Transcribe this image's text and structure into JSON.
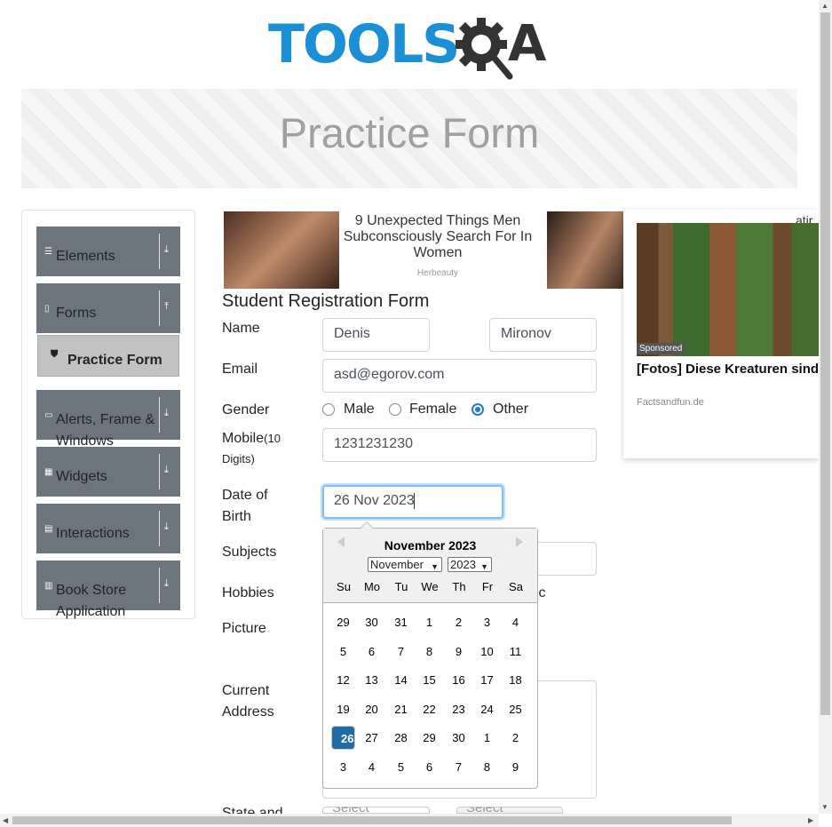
{
  "logo": {
    "text": "TOOLS",
    "text_a": "A",
    "gear_icon": "gear-magnifier-icon"
  },
  "banner": {
    "title": "Practice Form"
  },
  "sidebar": {
    "items": [
      {
        "label": "Elements",
        "icon": "hamburger-icon",
        "arrow": "download-arrow-icon"
      },
      {
        "label": "Forms",
        "icon": "document-icon",
        "arrow": "upload-arrow-icon"
      },
      {
        "label": "Alerts, Frame & Windows",
        "icon": "window-icon",
        "arrow": "download-arrow-icon"
      },
      {
        "label": "Widgets",
        "icon": "grid-icon",
        "arrow": "download-arrow-icon"
      },
      {
        "label": "Interactions",
        "icon": "square-icon",
        "arrow": "download-arrow-icon"
      },
      {
        "label": "Book Store Application",
        "icon": "books-icon",
        "arrow": "download-arrow-icon"
      }
    ],
    "subitem": {
      "label": "Practice Form",
      "icon": "html5-icon"
    }
  },
  "ad_strip": {
    "headline": "9 Unexpected Things Men Subconsciously Search For In Women",
    "source": "Herbeauty"
  },
  "side_ad": {
    "top_text": "atir",
    "sponsored": "Sponsored",
    "title": "[Fotos] Diese Kreaturen sind größer als wir uns vorstellen",
    "source": "Factsandfun.de"
  },
  "form": {
    "title": "Student Registration Form",
    "name_label": "Name",
    "first_name": "Denis",
    "last_name": "Mironov",
    "email_label": "Email",
    "email": "asd@egorov.com",
    "gender_label": "Gender",
    "gender_options": [
      "Male",
      "Female",
      "Other"
    ],
    "gender_selected": "Other",
    "mobile_label": "Mobile",
    "mobile_hint": "(10",
    "mobile_hint2": "Digits)",
    "mobile": "1231231230",
    "dob_label_1": "Date of",
    "dob_label_2": "Birth",
    "dob": "26 Nov 2023",
    "subjects_label": "Subjects",
    "hobbies_label": "Hobbies",
    "hobbies_partial": "ic",
    "picture_label": "Picture",
    "address_label_1": "Current",
    "address_label_2": "Address",
    "state_label": "State and",
    "state_placeholder": "Select",
    "city_placeholder": "Select"
  },
  "datepicker": {
    "month_title": "November 2023",
    "month_select": "November",
    "year_select": "2023",
    "day_names": [
      "Su",
      "Mo",
      "Tu",
      "We",
      "Th",
      "Fr",
      "Sa"
    ],
    "weeks": [
      [
        "29",
        "30",
        "31",
        "1",
        "2",
        "3",
        "4"
      ],
      [
        "5",
        "6",
        "7",
        "8",
        "9",
        "10",
        "11"
      ],
      [
        "12",
        "13",
        "14",
        "15",
        "16",
        "17",
        "18"
      ],
      [
        "19",
        "20",
        "21",
        "22",
        "23",
        "24",
        "25"
      ],
      [
        "26",
        "27",
        "28",
        "29",
        "30",
        "1",
        "2"
      ],
      [
        "3",
        "4",
        "5",
        "6",
        "7",
        "8",
        "9"
      ]
    ],
    "selected_day": "26",
    "accent": "#216ba5"
  },
  "colors": {
    "brand_blue": "#1b8fd6",
    "sidebar_bg": "#6c757d",
    "radio_accent": "#1f7ae0"
  }
}
